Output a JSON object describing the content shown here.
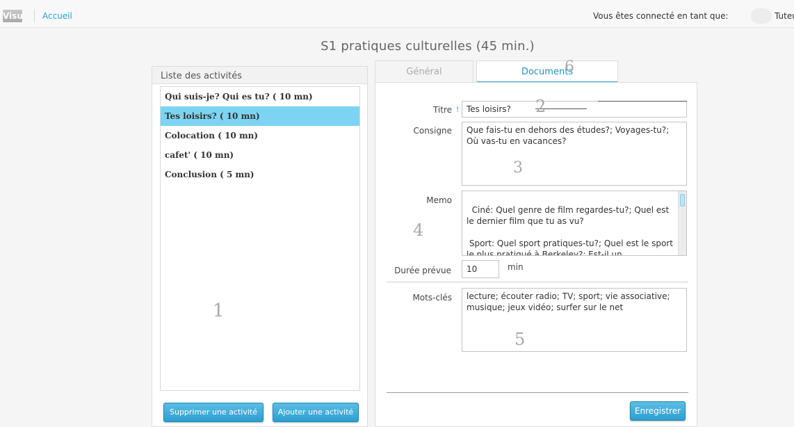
{
  "header": {
    "logo_text": "Visu",
    "nav_home": "Accueil",
    "connected_label": "Vous êtes connecté en tant que:",
    "user_name": "Tuteur"
  },
  "page_title": "S1 pratiques culturelles (45 min.)",
  "activities_panel": {
    "title": "Liste des activités",
    "items": [
      {
        "label": "Qui suis-je? Qui es tu? ( 10 mn)",
        "selected": false
      },
      {
        "label": "Tes loisirs? ( 10 mn)",
        "selected": true
      },
      {
        "label": "Colocation ( 10 mn)",
        "selected": false
      },
      {
        "label": "cafet' ( 10 mn)",
        "selected": false
      },
      {
        "label": "Conclusion ( 5 mn)",
        "selected": false
      }
    ],
    "delete_button": "Supprimer une activité",
    "add_button": "Ajouter une activité"
  },
  "tabs": [
    {
      "label": "Général",
      "active": false
    },
    {
      "label": "Documents",
      "active": true
    }
  ],
  "form": {
    "title_label": "Titre",
    "required_mark": "!",
    "title_value": "Tes loisirs?",
    "instruction_label": "Consigne",
    "instruction_value": "Que fais-tu en dehors des études?; Voyages-tu?; Où vas-tu en vacances?",
    "memo_label": "Memo",
    "memo_value": "Ciné: Quel genre de film regardes-tu?; Quel est le dernier film que tu as vu?\n\n Sport: Quel sport pratiques-tu?; Quel est le sport le plus pratiqué à Berkeley?; Est-il un",
    "duration_label": "Durée prévue",
    "duration_value": "10",
    "duration_unit": "min",
    "keywords_label": "Mots-clés",
    "keywords_value": "lecture; écouter radio; TV; sport; vie associative; musique; jeux vidéo; surfer sur le net",
    "save_button": "Enregistrer"
  },
  "annotations": {
    "n1": "1",
    "n2": "2",
    "n3": "3",
    "n4": "4",
    "n5": "5",
    "n6": "6"
  },
  "colors": {
    "accent": "#2a9fd6",
    "selected_row": "#7cd4f2",
    "button": "#3aa8d8"
  }
}
